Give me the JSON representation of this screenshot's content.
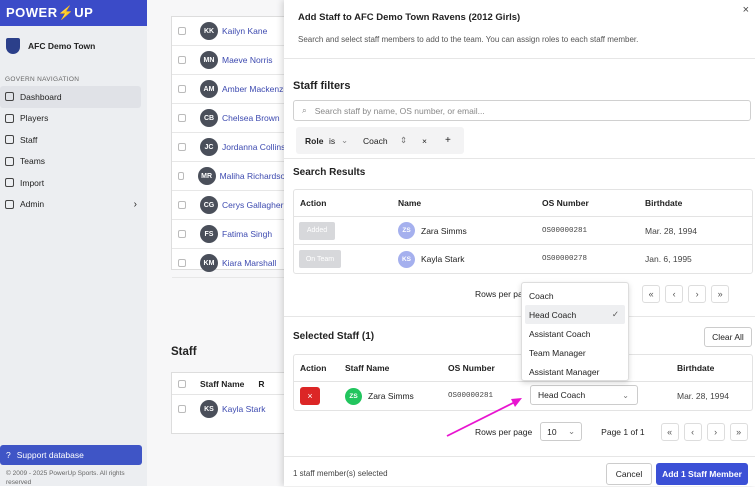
{
  "brand": {
    "name": "POWER⚡UP"
  },
  "club": {
    "name": "AFC Demo Town"
  },
  "sidebar": {
    "heading": "GOVERN NAVIGATION",
    "items": [
      {
        "label": "Dashboard",
        "icon": "home-icon"
      },
      {
        "label": "Players",
        "icon": "users-icon"
      },
      {
        "label": "Staff",
        "icon": "staff-icon"
      },
      {
        "label": "Teams",
        "icon": "shield-icon"
      },
      {
        "label": "Import",
        "icon": "upload-icon"
      },
      {
        "label": "Admin",
        "icon": "toggle-icon"
      }
    ],
    "support": "Support database",
    "copyright": "© 2009 - 2025 PowerUp Sports. All rights reserved"
  },
  "background": {
    "players": [
      {
        "initials": "KK",
        "name": "Kailyn Kane"
      },
      {
        "initials": "MN",
        "name": "Maeve Norris"
      },
      {
        "initials": "AM",
        "name": "Amber Mackenzie"
      },
      {
        "initials": "CB",
        "name": "Chelsea Brown"
      },
      {
        "initials": "JC",
        "name": "Jordanna Collins"
      },
      {
        "initials": "MR",
        "name": "Maliha Richardson"
      },
      {
        "initials": "CG",
        "name": "Cerys Gallagher"
      },
      {
        "initials": "FS",
        "name": "Fatima Singh"
      },
      {
        "initials": "KM",
        "name": "Kiara Marshall"
      }
    ],
    "staff_title": "Staff",
    "staff_header": {
      "col1": "Staff Name",
      "col2": "R"
    },
    "staff_row": {
      "initials": "KS",
      "name": "Kayla Stark"
    }
  },
  "panel": {
    "title": "Add Staff to AFC Demo Town Ravens (2012 Girls)",
    "subtitle": "Search and select staff members to add to the team. You can assign roles to each staff member.",
    "filters_title": "Staff filters",
    "search_placeholder": "Search staff by name, OS number, or email...",
    "filter": {
      "field": "Role",
      "op": "is",
      "value": "Coach",
      "remove": "×",
      "add": "+"
    },
    "results_title": "Search Results",
    "results_columns": {
      "action": "Action",
      "name": "Name",
      "os": "OS Number",
      "birth": "Birthdate"
    },
    "results": [
      {
        "tag": "Added",
        "initials": "ZS",
        "name": "Zara Simms",
        "os": "OS00000281",
        "birth": "Mar. 28, 1994"
      },
      {
        "tag": "On Team",
        "initials": "KS",
        "name": "Kayla Stark",
        "os": "OS00000278",
        "birth": "Jan. 6, 1995"
      }
    ],
    "results_pager": {
      "rows_label": "Rows per pa",
      "page": "f 1"
    },
    "selected_title": "Selected Staff (1)",
    "clear_all": "Clear All",
    "selected_columns": {
      "action": "Action",
      "name": "Staff Name",
      "os": "OS Number",
      "birth": "Birthdate"
    },
    "selected_row": {
      "delete": "×",
      "initials": "ZS",
      "name": "Zara Simms",
      "os": "OS00000281",
      "role": "Head Coach",
      "birth": "Mar. 28, 1994"
    },
    "role_options": [
      "Coach",
      "Head Coach",
      "Assistant Coach",
      "Team Manager",
      "Assistant Manager"
    ],
    "role_selected": "Head Coach",
    "pager": {
      "rows_label": "Rows per page",
      "rows_value": "10",
      "page": "Page 1 of 1"
    },
    "footer": {
      "count": "1 staff member(s) selected",
      "cancel": "Cancel",
      "add": "Add 1 Staff Member"
    }
  },
  "colors": {
    "brand": "#3b4bc8",
    "primary_button": "#3b50d6",
    "delete": "#dc2626",
    "annotation_arrow": "#e815d0"
  }
}
